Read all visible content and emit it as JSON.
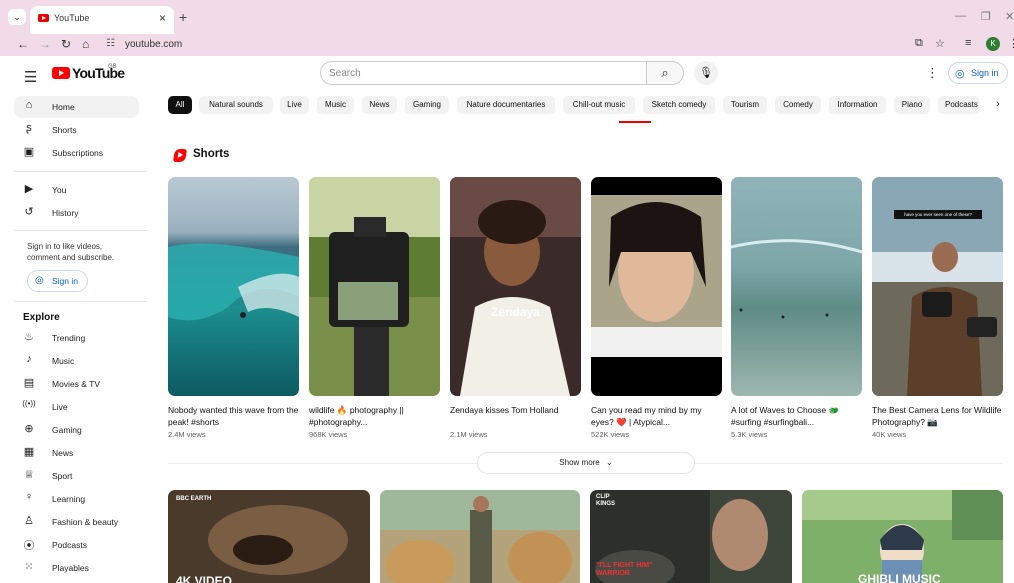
{
  "browser": {
    "tab_title": "YouTube",
    "tab_close": "×",
    "new_tab": "+",
    "url": "youtube.com"
  },
  "header": {
    "logo_text": "YouTube",
    "country_code": "GB",
    "search_placeholder": "Search",
    "sign_in": "Sign in"
  },
  "sidebar": {
    "main": [
      {
        "label": "Home",
        "icon": "home-icon",
        "active": true
      },
      {
        "label": "Shorts",
        "icon": "shorts-icon"
      },
      {
        "label": "Subscriptions",
        "icon": "subscriptions-icon"
      }
    ],
    "you": [
      {
        "label": "You",
        "icon": "you-icon"
      },
      {
        "label": "History",
        "icon": "history-icon"
      }
    ],
    "signin_note": "Sign in to like videos, comment and subscribe.",
    "signin_button": "Sign in",
    "explore_title": "Explore",
    "explore": [
      {
        "label": "Trending",
        "icon": "trending-icon"
      },
      {
        "label": "Music",
        "icon": "music-icon"
      },
      {
        "label": "Movies & TV",
        "icon": "movies-icon"
      },
      {
        "label": "Live",
        "icon": "live-icon"
      },
      {
        "label": "Gaming",
        "icon": "gaming-icon"
      },
      {
        "label": "News",
        "icon": "news-icon"
      },
      {
        "label": "Sport",
        "icon": "sport-icon"
      },
      {
        "label": "Learning",
        "icon": "learning-icon"
      },
      {
        "label": "Fashion & beauty",
        "icon": "fashion-icon"
      },
      {
        "label": "Podcasts",
        "icon": "podcasts-icon"
      },
      {
        "label": "Playables",
        "icon": "playables-icon"
      }
    ]
  },
  "chips": [
    "All",
    "Natural sounds",
    "Live",
    "Music",
    "News",
    "Gaming",
    "Nature documentaries",
    "Chill-out music",
    "Sketch comedy",
    "Tourism",
    "Comedy",
    "Information",
    "Piano",
    "Podcasts"
  ],
  "shorts": {
    "title": "Shorts",
    "items": [
      {
        "title": "Nobody wanted this wave from the peak! #shorts",
        "views": "2.4M views"
      },
      {
        "title": "wildlife 🔥 photography || #photography...",
        "views": "968K views"
      },
      {
        "title": "Zendaya kisses Tom Holland",
        "views": "2.1M views",
        "overlay": "Zendaya"
      },
      {
        "title": "Can you read my mind by my eyes? ❤️ | Atypical...",
        "views": "522K views"
      },
      {
        "title": "A lot of Waves to Choose 🐲 #surfing #surfingbali...",
        "views": "5.3K views"
      },
      {
        "title": "The Best Camera Lens for Wildlife Photography? 📷",
        "views": "40K views",
        "overlay": "have you ever seen one of these?"
      }
    ],
    "show_more": "Show more"
  },
  "videos": [
    {
      "overlay_top": "BBC EARTH",
      "overlay_bottom": "4K VIDEO"
    },
    {
      "overlay_top": "",
      "overlay_bottom": ""
    },
    {
      "overlay_top": "CLIP KINGS",
      "overlay_bottom": "\"I'LL FIGHT HIM\" WARRIOR"
    },
    {
      "overlay_top": "",
      "overlay_bottom": "GHIBLI MUSIC"
    }
  ]
}
